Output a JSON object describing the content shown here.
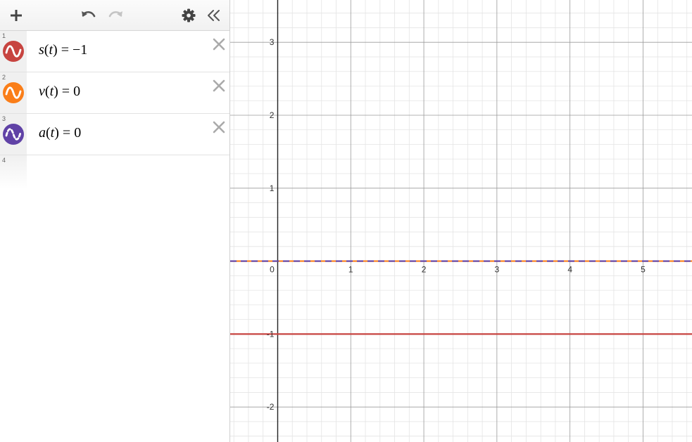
{
  "toolbar": {
    "add_icon": "plus-icon",
    "undo_icon": "undo-icon",
    "redo_icon": "redo-icon",
    "settings_icon": "gear-icon",
    "collapse_icon": "double-chevron-left-icon"
  },
  "expressions": [
    {
      "index": "1",
      "func": "s",
      "var": "t",
      "rhs": "−1",
      "color": "#c74440",
      "icon": "wave-icon",
      "line_style": "solid"
    },
    {
      "index": "2",
      "func": "v",
      "var": "t",
      "rhs": "0",
      "color": "#fa7e19",
      "icon": "wave-icon",
      "line_style": "solid"
    },
    {
      "index": "3",
      "func": "a",
      "var": "t",
      "rhs": "0",
      "color": "#6042a6",
      "icon": "dashed-wave-icon",
      "line_style": "dashed"
    },
    {
      "index": "4"
    }
  ],
  "graph": {
    "x_ticks": [
      "0",
      "1",
      "2",
      "3",
      "4",
      "5"
    ],
    "y_ticks": [
      "3",
      "2",
      "1",
      "-1",
      "-2"
    ],
    "xlim": [
      -0.65,
      5.67
    ],
    "ylim": [
      -2.48,
      3.58
    ],
    "grid": true,
    "minor_grid": true,
    "curves": [
      {
        "expr": "s(t) = -1",
        "y": -1,
        "color": "#c74440",
        "style": "solid"
      },
      {
        "expr": "v(t) = 0",
        "y": 0,
        "color": "#fa7e19",
        "style": "solid"
      },
      {
        "expr": "a(t) = 0",
        "y": 0,
        "color": "#6042a6",
        "style": "dashed"
      }
    ]
  }
}
